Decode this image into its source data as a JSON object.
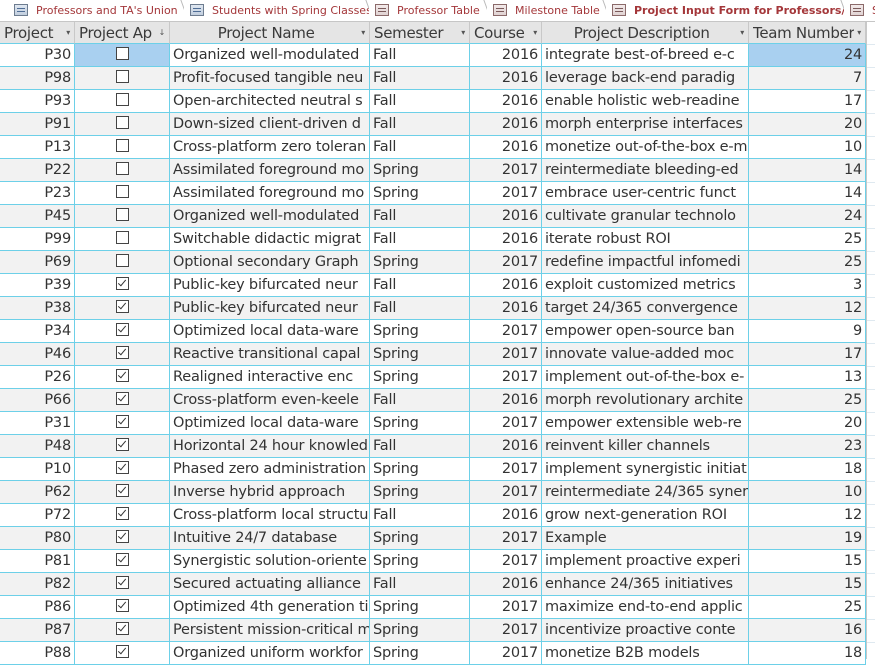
{
  "tabs": [
    {
      "label": "Professors and TA's Union",
      "icon": "query-icon",
      "active": false
    },
    {
      "label": "Students with Spring Classes",
      "icon": "query-icon",
      "active": false
    },
    {
      "label": "Professor Table",
      "icon": "form-icon",
      "active": false
    },
    {
      "label": "Milestone Table",
      "icon": "form-icon",
      "active": false
    },
    {
      "label": "Project Input Form for Professors/TA's",
      "icon": "form-icon",
      "active": true
    },
    {
      "label": "S",
      "icon": "form-icon",
      "active": false
    }
  ],
  "columns": [
    {
      "label": "Project",
      "arrow": "▾"
    },
    {
      "label": "Project Ap",
      "arrow": "↓"
    },
    {
      "label": "Project Name",
      "arrow": "▾"
    },
    {
      "label": "Semester",
      "arrow": "▾"
    },
    {
      "label": "Course",
      "arrow": "▾"
    },
    {
      "label": "Project Description",
      "arrow": "▾"
    },
    {
      "label": "Team Number",
      "arrow": "▾"
    }
  ],
  "rows": [
    {
      "id": "P30",
      "approved": false,
      "name": "Organized well-modulated",
      "semester": "Fall",
      "course": "2016",
      "desc": "integrate best-of-breed e-c",
      "team": "24"
    },
    {
      "id": "P98",
      "approved": false,
      "name": "Profit-focused tangible neu",
      "semester": "Fall",
      "course": "2016",
      "desc": "leverage back-end paradig",
      "team": "7"
    },
    {
      "id": "P93",
      "approved": false,
      "name": "Open-architected neutral s",
      "semester": "Fall",
      "course": "2016",
      "desc": "enable holistic web-readine",
      "team": "17"
    },
    {
      "id": "P91",
      "approved": false,
      "name": "Down-sized client-driven d",
      "semester": "Fall",
      "course": "2016",
      "desc": "morph enterprise interfaces",
      "team": "20"
    },
    {
      "id": "P13",
      "approved": false,
      "name": "Cross-platform zero toleran",
      "semester": "Fall",
      "course": "2016",
      "desc": "monetize out-of-the-box e-m",
      "team": "10"
    },
    {
      "id": "P22",
      "approved": false,
      "name": "Assimilated foreground mo",
      "semester": "Spring",
      "course": "2017",
      "desc": "reintermediate bleeding-ed",
      "team": "14"
    },
    {
      "id": "P23",
      "approved": false,
      "name": "Assimilated foreground mo",
      "semester": "Spring",
      "course": "2017",
      "desc": "embrace user-centric funct",
      "team": "14"
    },
    {
      "id": "P45",
      "approved": false,
      "name": "Organized well-modulated",
      "semester": "Fall",
      "course": "2016",
      "desc": "cultivate granular technolo",
      "team": "24"
    },
    {
      "id": "P99",
      "approved": false,
      "name": "Switchable didactic migrat",
      "semester": "Fall",
      "course": "2016",
      "desc": "iterate robust ROI",
      "team": "25"
    },
    {
      "id": "P69",
      "approved": false,
      "name": "Optional secondary Graph",
      "semester": "Spring",
      "course": "2017",
      "desc": "redefine impactful infomedi",
      "team": "25"
    },
    {
      "id": "P39",
      "approved": true,
      "name": "Public-key bifurcated neur",
      "semester": "Fall",
      "course": "2016",
      "desc": "exploit customized metrics",
      "team": "3"
    },
    {
      "id": "P38",
      "approved": true,
      "name": "Public-key bifurcated neur",
      "semester": "Fall",
      "course": "2016",
      "desc": "target 24/365 convergence",
      "team": "12"
    },
    {
      "id": "P34",
      "approved": true,
      "name": "Optimized local data-ware",
      "semester": "Spring",
      "course": "2017",
      "desc": "empower open-source ban",
      "team": "9"
    },
    {
      "id": "P46",
      "approved": true,
      "name": "Reactive transitional capal",
      "semester": "Spring",
      "course": "2017",
      "desc": "innovate value-added moc",
      "team": "17"
    },
    {
      "id": "P26",
      "approved": true,
      "name": "Realigned interactive enc",
      "semester": "Spring",
      "course": "2017",
      "desc": "implement out-of-the-box e-",
      "team": "13"
    },
    {
      "id": "P66",
      "approved": true,
      "name": "Cross-platform even-keele",
      "semester": "Fall",
      "course": "2016",
      "desc": "morph revolutionary archite",
      "team": "25"
    },
    {
      "id": "P31",
      "approved": true,
      "name": "Optimized local data-ware",
      "semester": "Spring",
      "course": "2017",
      "desc": "empower extensible web-re",
      "team": "20"
    },
    {
      "id": "P48",
      "approved": true,
      "name": "Horizontal 24 hour knowled",
      "semester": "Fall",
      "course": "2016",
      "desc": "reinvent killer channels",
      "team": "23"
    },
    {
      "id": "P10",
      "approved": true,
      "name": "Phased zero administration",
      "semester": "Spring",
      "course": "2017",
      "desc": "implement synergistic initiati",
      "team": "18"
    },
    {
      "id": "P62",
      "approved": true,
      "name": "Inverse hybrid approach",
      "semester": "Spring",
      "course": "2017",
      "desc": "reintermediate 24/365 syner",
      "team": "10"
    },
    {
      "id": "P72",
      "approved": true,
      "name": "Cross-platform local structu",
      "semester": "Fall",
      "course": "2016",
      "desc": "grow next-generation ROI",
      "team": "12"
    },
    {
      "id": "P80",
      "approved": true,
      "name": "Intuitive 24/7 database",
      "semester": "Spring",
      "course": "2017",
      "desc": "Example",
      "team": "19"
    },
    {
      "id": "P81",
      "approved": true,
      "name": "Synergistic solution-oriente",
      "semester": "Spring",
      "course": "2017",
      "desc": "implement proactive experi",
      "team": "15"
    },
    {
      "id": "P82",
      "approved": true,
      "name": "Secured actuating alliance",
      "semester": "Fall",
      "course": "2016",
      "desc": "enhance 24/365 initiatives",
      "team": "15"
    },
    {
      "id": "P86",
      "approved": true,
      "name": "Optimized 4th generation ti",
      "semester": "Spring",
      "course": "2017",
      "desc": "maximize end-to-end applic",
      "team": "25"
    },
    {
      "id": "P87",
      "approved": true,
      "name": "Persistent mission-critical m",
      "semester": "Spring",
      "course": "2017",
      "desc": "incentivize proactive conte",
      "team": "16"
    },
    {
      "id": "P88",
      "approved": true,
      "name": "Organized uniform workfor",
      "semester": "Spring",
      "course": "2017",
      "desc": "monetize B2B models",
      "team": "18"
    }
  ],
  "selected_row": 0
}
